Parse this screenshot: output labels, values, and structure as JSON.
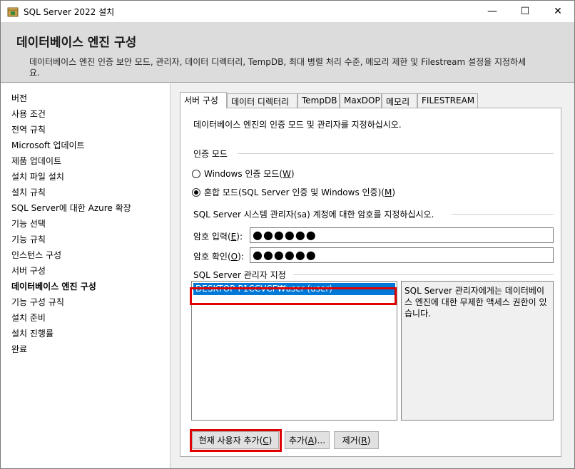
{
  "window": {
    "title": "SQL Server 2022 설치",
    "minimize": "—",
    "maximize": "☐",
    "close": "✕"
  },
  "header": {
    "title": "데이터베이스 엔진 구성",
    "description": "데이터베이스 엔진 인증 보안 모드, 관리자, 데이터 디렉터리, TempDB, 최대 병렬 처리 수준, 메모리 제한 및 Filestream 설정을 지정하세요."
  },
  "nav": {
    "items": [
      {
        "label": "버전"
      },
      {
        "label": "사용 조건"
      },
      {
        "label": "전역 규칙"
      },
      {
        "label": "Microsoft 업데이트"
      },
      {
        "label": "제품 업데이트"
      },
      {
        "label": "설치 파일 설치"
      },
      {
        "label": "설치 규칙"
      },
      {
        "label": "SQL Server에 대한 Azure 확장"
      },
      {
        "label": "기능 선택"
      },
      {
        "label": "기능 규칙"
      },
      {
        "label": "인스턴스 구성"
      },
      {
        "label": "서버 구성"
      },
      {
        "label": "데이터베이스 엔진 구성"
      },
      {
        "label": "기능 구성 규칙"
      },
      {
        "label": "설치 준비"
      },
      {
        "label": "설치 진행률"
      },
      {
        "label": "완료"
      }
    ],
    "active_index": 12
  },
  "tabs": [
    {
      "label": "서버 구성"
    },
    {
      "label": "데이터 디렉터리"
    },
    {
      "label": "TempDB"
    },
    {
      "label": "MaxDOP"
    },
    {
      "label": "메모리"
    },
    {
      "label": "FILESTREAM"
    }
  ],
  "server_config": {
    "instruction": "데이터베이스 엔진의 인증 모드 및 관리자를 지정하십시오.",
    "auth_mode": {
      "group_label": "인증 모드",
      "windows_label": "Windows 인증 모드(",
      "windows_key": "W",
      "mixed_label": "혼합 모드(SQL Server 인증 및 Windows 인증)(",
      "mixed_key": "M",
      "close_paren": ")",
      "selected": "mixed"
    },
    "sa": {
      "group_label": "SQL Server 시스템 관리자(sa) 계정에 대한 암호를 지정하십시오.",
      "password_label": "암호 입력(",
      "password_key": "E",
      "confirm_label": "암호 확인(",
      "confirm_key": "O",
      "label_suffix": "):",
      "password_value": "●●●●●●",
      "confirm_value": "●●●●●●"
    },
    "admins": {
      "group_label": "SQL Server 관리자 지정",
      "entries": [
        "DESKTOP-P1CCVCF₩user (user)"
      ],
      "description": "SQL Server 관리자에게는 데이터베이스 엔진에 대한 무제한 액세스 권한이 있습니다."
    },
    "buttons": {
      "add_current": "현재 사용자 추가(",
      "add_current_key": "C",
      "add": "추가(",
      "add_key": "A",
      "add_suffix": ")...",
      "remove": "제거(",
      "remove_key": "R",
      "close_paren": ")"
    }
  },
  "colors": {
    "highlight_red": "#e00000",
    "selection_blue": "#0078d7"
  }
}
